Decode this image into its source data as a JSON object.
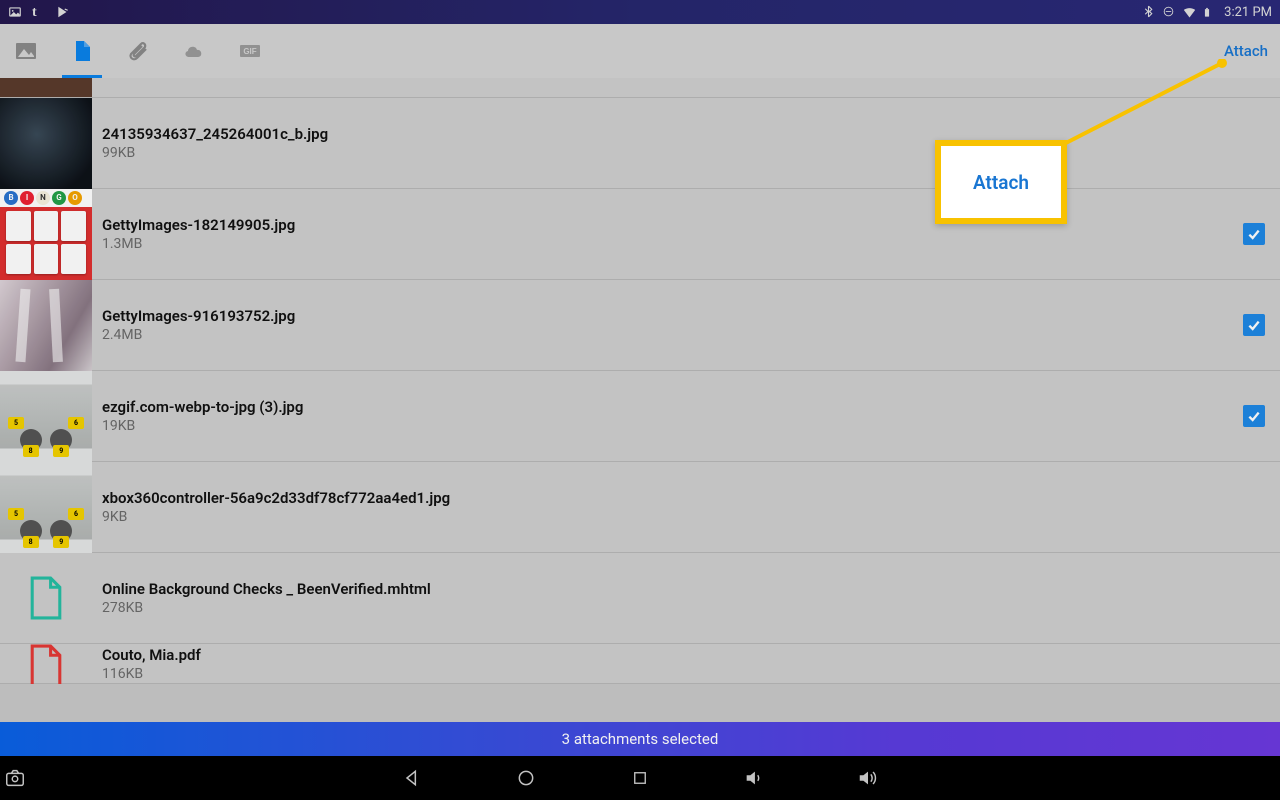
{
  "statusbar": {
    "time": "3:21 PM"
  },
  "toolbar": {
    "attach_label": "Attach",
    "active_tab_index": 1
  },
  "callout": {
    "label": "Attach"
  },
  "banner": {
    "text": "3 attachments selected"
  },
  "files": [
    {
      "name": "24135934637_245264001c_b.jpg",
      "size": "99KB",
      "selected": false,
      "thumb": "dark-game"
    },
    {
      "name": "GettyImages-182149905.jpg",
      "size": "1.3MB",
      "selected": true,
      "thumb": "bingo"
    },
    {
      "name": "GettyImages-916193752.jpg",
      "size": "2.4MB",
      "selected": true,
      "thumb": "fashion"
    },
    {
      "name": "ezgif.com-webp-to-jpg (3).jpg",
      "size": "19KB",
      "selected": true,
      "thumb": "controller"
    },
    {
      "name": "xbox360controller-56a9c2d33df78cf772aa4ed1.jpg",
      "size": "9KB",
      "selected": false,
      "thumb": "controller"
    },
    {
      "name": "Online Background Checks _ BeenVerified.mhtml",
      "size": "278KB",
      "selected": false,
      "thumb": "file-generic"
    },
    {
      "name": "Couto, Mia.pdf",
      "size": "116KB",
      "selected": false,
      "thumb": "file-pdf"
    }
  ]
}
